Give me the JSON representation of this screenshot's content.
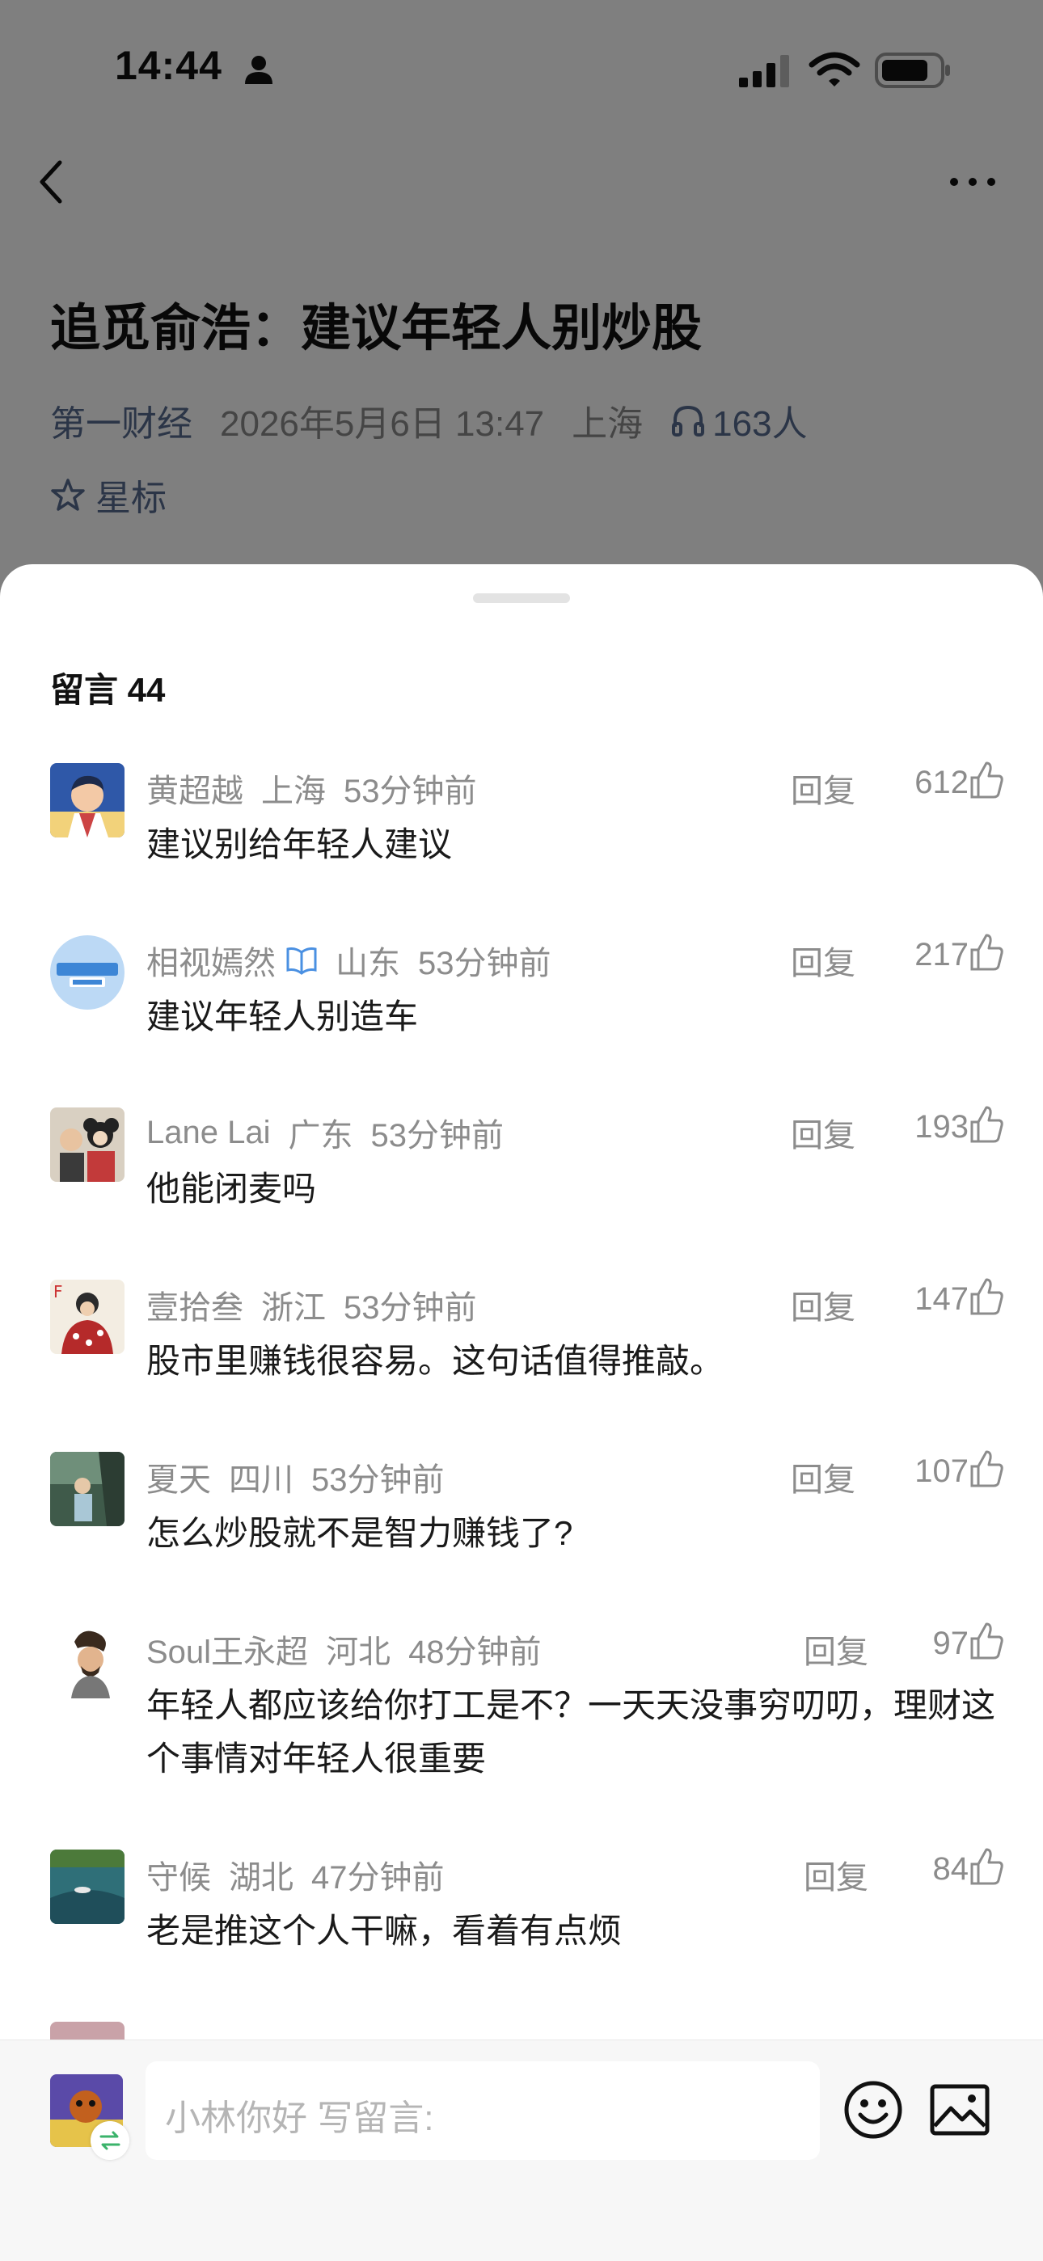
{
  "status_bar": {
    "time": "14:44"
  },
  "article": {
    "title": "追觅俞浩：建议年轻人别炒股",
    "source": "第一财经",
    "datetime": "2026年5月6日 13:47",
    "location": "上海",
    "listeners": "163人",
    "star_label": "星标"
  },
  "comments_panel": {
    "heading": "留言 44",
    "reply_label": "回复",
    "comments": [
      {
        "name": "黄超越",
        "location": "上海",
        "time": "53分钟前",
        "likes": "612",
        "text": "建议别给年轻人建议"
      },
      {
        "name": "相视嫣然",
        "location": "山东",
        "time": "53分钟前",
        "likes": "217",
        "text": "建议年轻人别造车"
      },
      {
        "name": "Lane Lai",
        "location": "广东",
        "time": "53分钟前",
        "likes": "193",
        "text": "他能闭麦吗"
      },
      {
        "name": "壹拾叁",
        "location": "浙江",
        "time": "53分钟前",
        "likes": "147",
        "text": "股市里赚钱很容易。这句话值得推敲。"
      },
      {
        "name": "夏天",
        "location": "四川",
        "time": "53分钟前",
        "likes": "107",
        "text": "怎么炒股就不是智力赚钱了?"
      },
      {
        "name": "Soul王永超",
        "location": "河北",
        "time": "48分钟前",
        "likes": "97",
        "text": "年轻人都应该给你打工是不？一天天没事穷叨叨，理财这个事情对年轻人很重要"
      },
      {
        "name": "守候",
        "location": "湖北",
        "time": "47分钟前",
        "likes": "84",
        "text": "老是推这个人干嘛，看着有点烦"
      }
    ]
  },
  "input_bar": {
    "placeholder": "小林你好 写留言:"
  },
  "icons": {
    "back": "chevron-left-icon",
    "more": "more-dots-icon",
    "like": "thumbs-up-icon",
    "emoji": "emoji-icon",
    "image": "image-icon",
    "star": "star-icon",
    "headphones": "headphones-icon",
    "verified": "open-book-verified-icon"
  },
  "colors": {
    "link_blue": "#566a8f",
    "overlay": "rgba(0,0,0,0.5)"
  }
}
